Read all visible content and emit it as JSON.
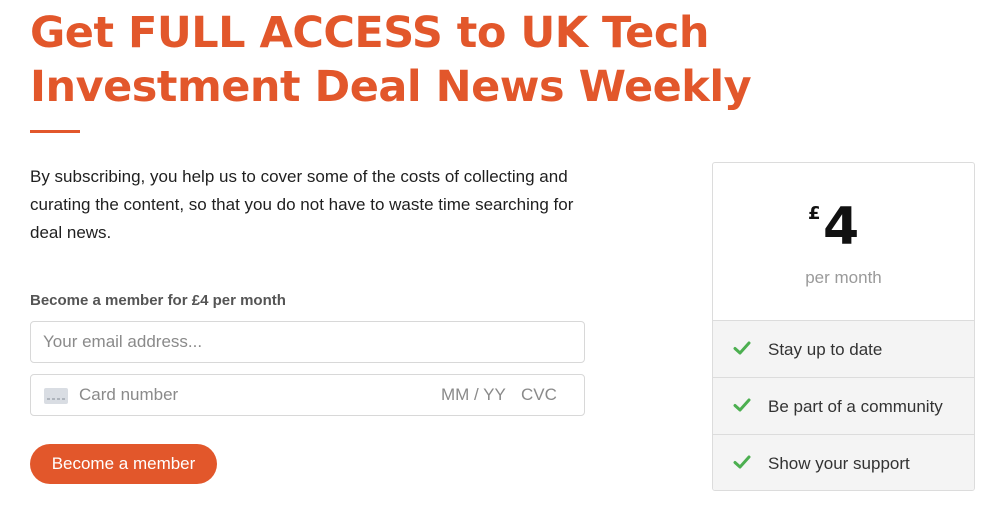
{
  "headline": "Get FULL ACCESS to UK Tech Investment Deal News Weekly",
  "intro": "By subscribing, you help us to cover some of the costs of collecting and curating the content, so that you do not have to waste time searching for deal news.",
  "form": {
    "label": "Become a member for £4 per month",
    "email_placeholder": "Your email address...",
    "card_number_placeholder": "Card number",
    "card_expiry_placeholder": "MM / YY",
    "card_cvc_placeholder": "CVC",
    "submit_label": "Become a member"
  },
  "pricing": {
    "currency": "£",
    "amount": "4",
    "period": "per month",
    "features": [
      {
        "label": "Stay up to date",
        "icon": "check-icon"
      },
      {
        "label": "Be part of a community",
        "icon": "check-icon"
      },
      {
        "label": "Show your support",
        "icon": "check-icon"
      }
    ]
  },
  "colors": {
    "accent": "#e2572b",
    "check": "#4caf50",
    "feature_bg": "#f4f4f4"
  }
}
